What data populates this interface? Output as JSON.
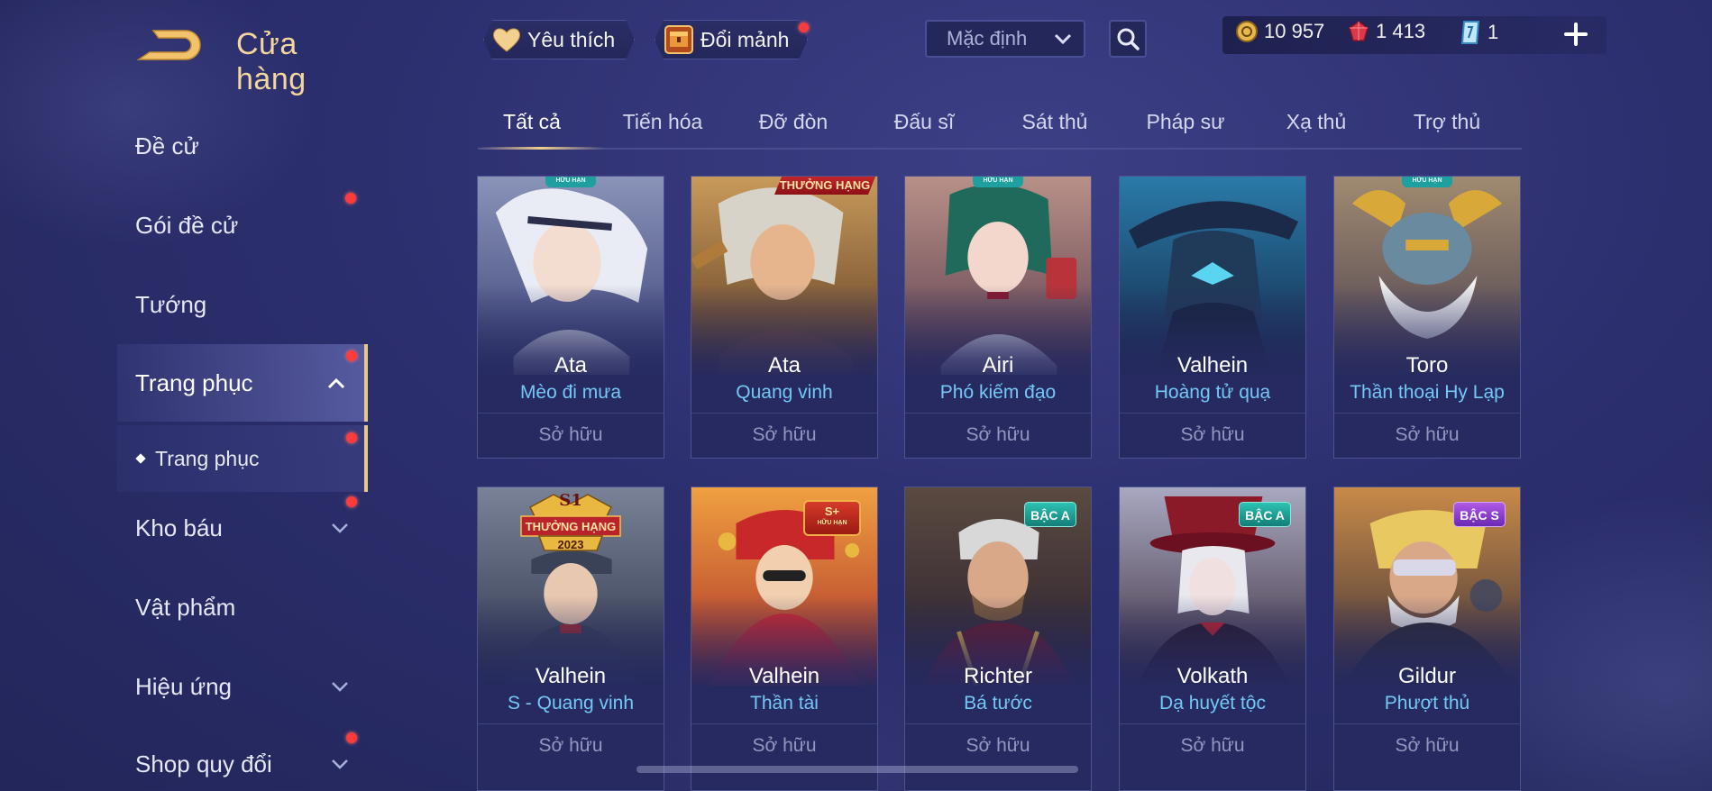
{
  "header": {
    "title": "Cửa hàng",
    "favorites_label": "Yêu thích",
    "exchange_label": "Đổi mảnh",
    "sort_value": "Mặc định"
  },
  "currencies": {
    "gold": "10 957",
    "gems": "1 413",
    "vouchers": "1"
  },
  "sidebar": {
    "items": [
      {
        "label": "Đề cử"
      },
      {
        "label": "Gói đề cử"
      },
      {
        "label": "Tướng"
      },
      {
        "label": "Trang phục"
      },
      {
        "label": "Trang phục"
      },
      {
        "label": "Kho báu"
      },
      {
        "label": "Vật phẩm"
      },
      {
        "label": "Hiệu ứng"
      },
      {
        "label": "Shop quy đổi"
      }
    ]
  },
  "tabs": [
    {
      "label": "Tất cả",
      "active": true
    },
    {
      "label": "Tiến hóa"
    },
    {
      "label": "Đỡ đòn"
    },
    {
      "label": "Đấu sĩ"
    },
    {
      "label": "Sát thủ"
    },
    {
      "label": "Pháp sư"
    },
    {
      "label": "Xạ thủ"
    },
    {
      "label": "Trợ thủ"
    }
  ],
  "cards": [
    {
      "hero": "Ata",
      "skin": "Mèo đi mưa",
      "status": "Sở hữu",
      "badge": "HỮU HẠN"
    },
    {
      "hero": "Ata",
      "skin": "Quang vinh",
      "status": "Sở hữu",
      "badge": "THƯỞNG HẠNG"
    },
    {
      "hero": "Airi",
      "skin": "Phó kiếm đạo",
      "status": "Sở hữu",
      "badge": "HỮU HẠN"
    },
    {
      "hero": "Valhein",
      "skin": "Hoàng tử quạ",
      "status": "Sở hữu",
      "badge": ""
    },
    {
      "hero": "Toro",
      "skin": "Thần thoại Hy Lạp",
      "status": "Sở hữu",
      "badge": "HỮU HẠN"
    },
    {
      "hero": "Valhein",
      "skin": "S - Quang vinh",
      "status": "Sở hữu",
      "badge_top": "S1",
      "badge_mid": "THƯỞNG HẠNG",
      "badge_bot": "2023"
    },
    {
      "hero": "Valhein",
      "skin": "Thần tài",
      "status": "Sở hữu",
      "badge_top": "S+",
      "badge_bot": "HỮU HẠN"
    },
    {
      "hero": "Richter",
      "skin": "Bá tước",
      "status": "Sở hữu",
      "badge": "BẬC A"
    },
    {
      "hero": "Volkath",
      "skin": "Dạ huyết tộc",
      "status": "Sở hữu",
      "badge": "BẬC A"
    },
    {
      "hero": "Gildur",
      "skin": "Phượt thủ",
      "status": "Sở hữu",
      "badge": "BẬC S"
    }
  ],
  "colors": {
    "accent_gold": "#f3d79c",
    "skin_name": "#74c8f5",
    "owned": "#9397c0",
    "notify_red": "#ff3a3a"
  }
}
